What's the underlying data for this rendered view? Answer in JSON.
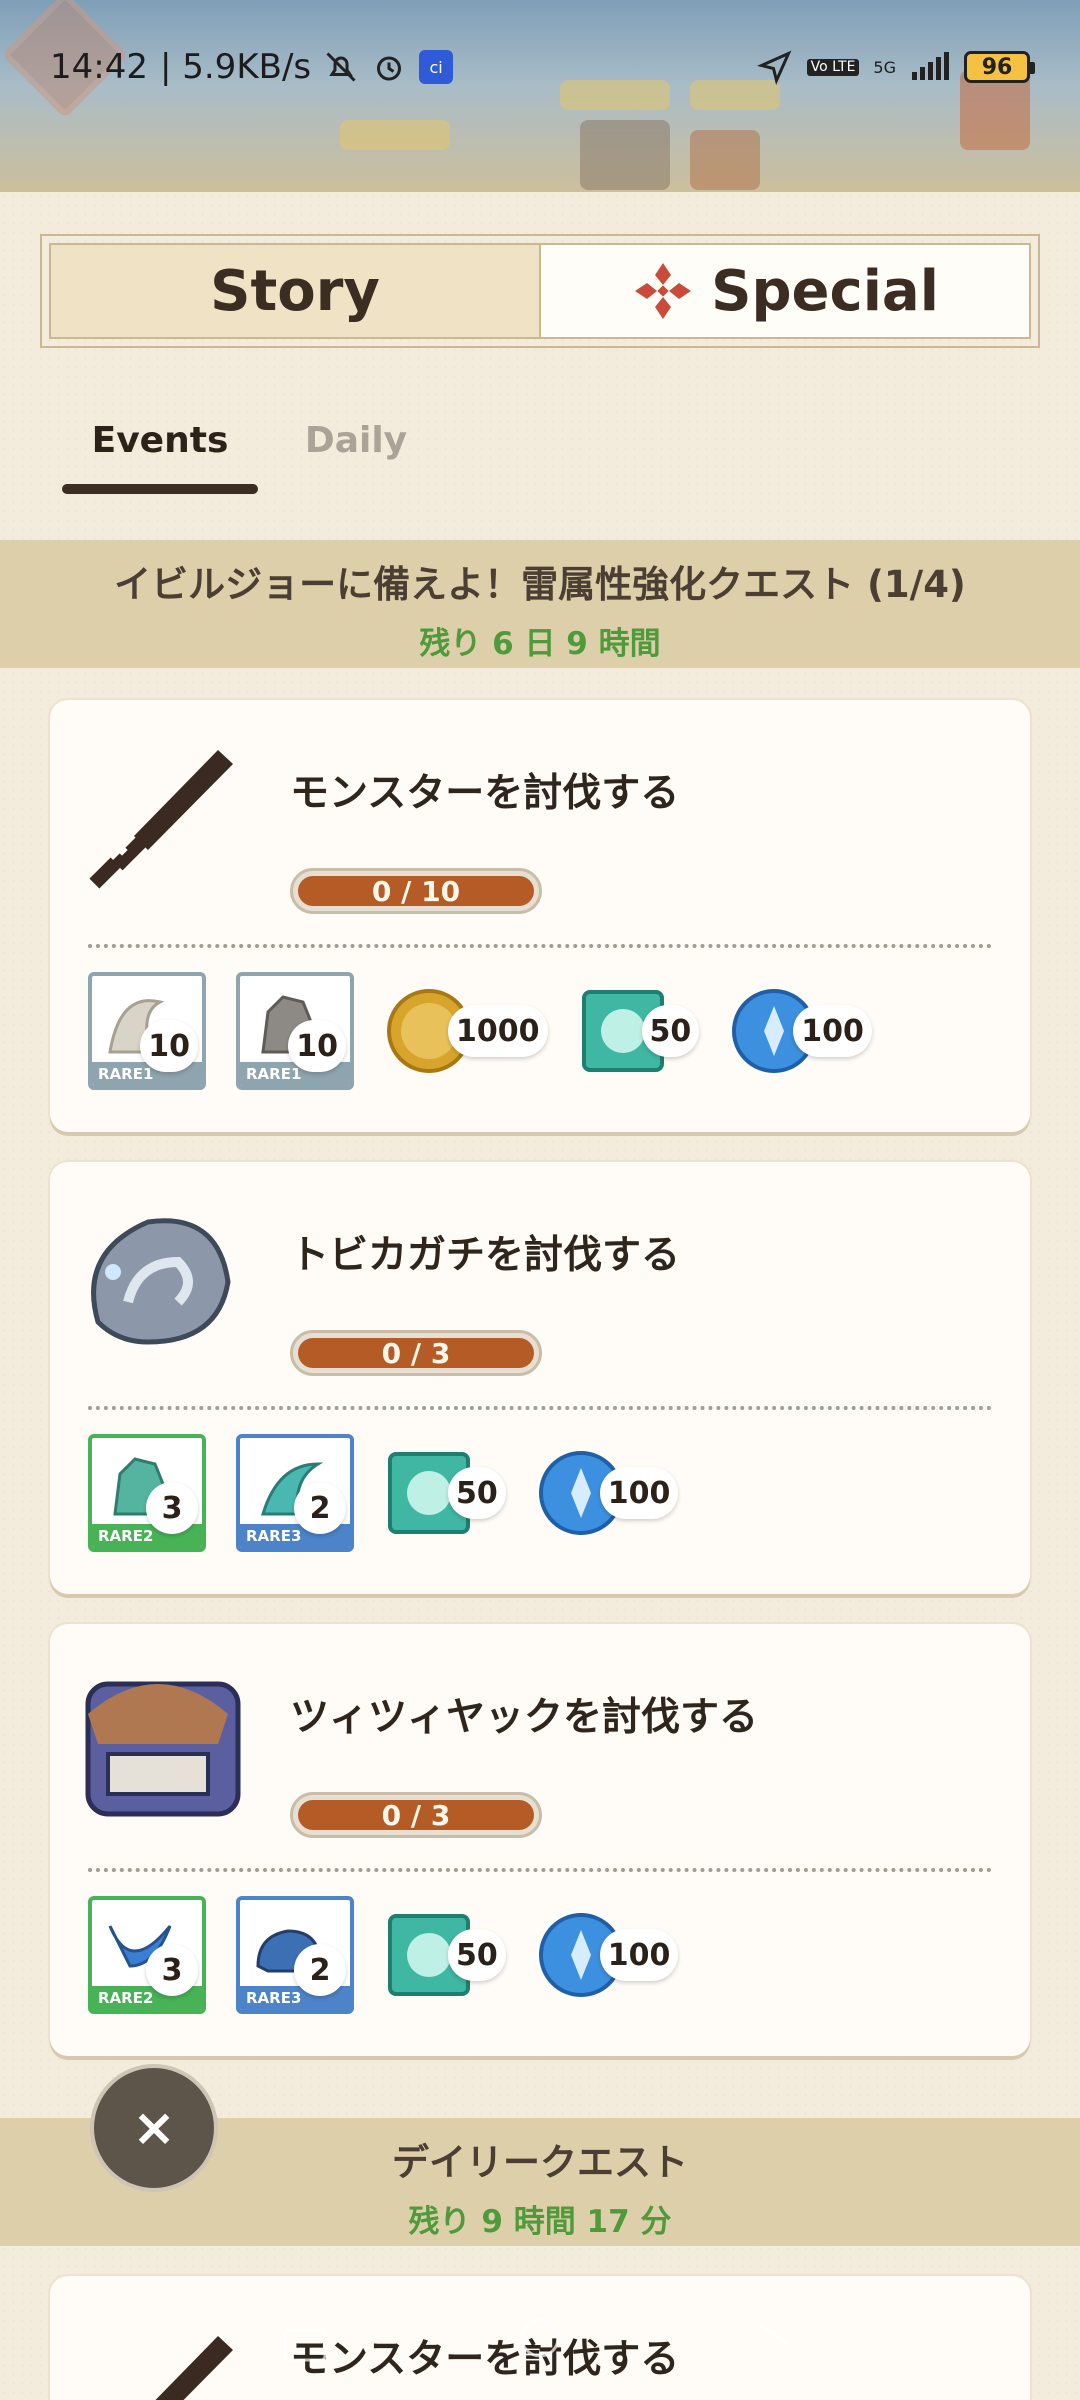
{
  "status_bar": {
    "time": "14:42",
    "speed": "| 5.9KB/s",
    "network": "5G",
    "volte": "Vo LTE",
    "battery": "96"
  },
  "mode_tabs": {
    "story": "Story",
    "special": "Special"
  },
  "sub_tabs": {
    "events": "Events",
    "daily": "Daily"
  },
  "event_section": {
    "title": "イビルジョーに備えよ！雷属性強化クエスト (1/4)",
    "remaining": "残り 6 日 9 時間"
  },
  "quests": [
    {
      "title": "モンスターを討伐する",
      "progress": "0 / 10",
      "progress_fraction": 0,
      "materials": [
        {
          "rarity": "RARE1",
          "count": "10",
          "icon": "claw-material-icon"
        },
        {
          "rarity": "RARE1",
          "count": "10",
          "icon": "hide-material-icon"
        }
      ],
      "currencies": [
        {
          "icon": "zenny-coin-icon",
          "count": "1000"
        },
        {
          "icon": "green-gem-icon",
          "count": "50"
        },
        {
          "icon": "blue-point-icon",
          "count": "100"
        }
      ]
    },
    {
      "title": "トビカガチを討伐する",
      "progress": "0 / 3",
      "progress_fraction": 0,
      "materials": [
        {
          "rarity": "RARE2",
          "count": "3",
          "icon": "green-hide-material-icon"
        },
        {
          "rarity": "RARE3",
          "count": "2",
          "icon": "blue-claw-material-icon"
        }
      ],
      "currencies": [
        {
          "icon": "green-gem-icon",
          "count": "50"
        },
        {
          "icon": "blue-point-icon",
          "count": "100"
        }
      ]
    },
    {
      "title": "ツィツィヤックを討伐する",
      "progress": "0 / 3",
      "progress_fraction": 0,
      "materials": [
        {
          "rarity": "RARE2",
          "count": "3",
          "icon": "blue-horn-material-icon"
        },
        {
          "rarity": "RARE3",
          "count": "2",
          "icon": "blue-shell-material-icon"
        }
      ],
      "currencies": [
        {
          "icon": "green-gem-icon",
          "count": "50"
        },
        {
          "icon": "blue-point-icon",
          "count": "100"
        }
      ]
    },
    {
      "title": "モンスターを討伐する"
    }
  ],
  "daily_section": {
    "title": "デイリークエスト",
    "remaining": "残り 9 時間 17 分"
  },
  "close_button": "×",
  "colors": {
    "progress": "#b55b26",
    "time_green": "#4f9a3b",
    "rare1": "#8ea4ae",
    "rare2": "#48b257",
    "rare3": "#4c83c9"
  }
}
